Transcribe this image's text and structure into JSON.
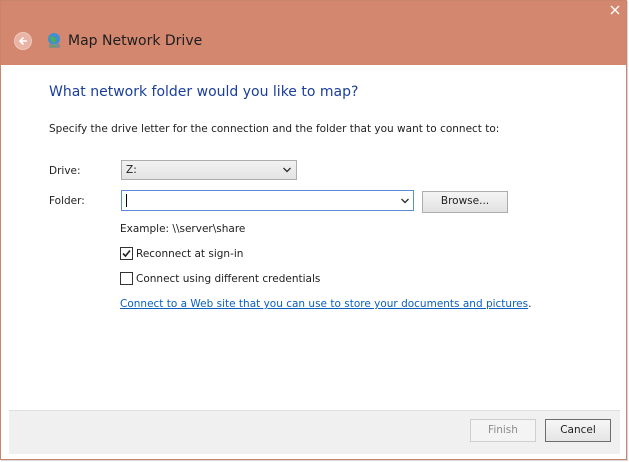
{
  "window": {
    "title": "Map Network Drive",
    "accent_color": "#d3876f"
  },
  "header": {
    "back_icon": "back-arrow-icon",
    "app_icon": "network-drive-icon"
  },
  "main": {
    "heading": "What network folder would you like to map?",
    "instruction": "Specify the drive letter for the connection and the folder that you want to connect to:",
    "drive": {
      "label": "Drive:",
      "selected": "Z:"
    },
    "folder": {
      "label": "Folder:",
      "value": ""
    },
    "browse_label": "Browse...",
    "example": "Example: \\\\server\\share",
    "reconnect": {
      "label": "Reconnect at sign-in",
      "checked": true
    },
    "different_credentials": {
      "label": "Connect using different credentials",
      "checked": false
    },
    "web_link": {
      "text": "Connect to a Web site that you can use to store your documents and pictures",
      "suffix": "."
    }
  },
  "footer": {
    "finish_label": "Finish",
    "finish_enabled": false,
    "cancel_label": "Cancel"
  }
}
